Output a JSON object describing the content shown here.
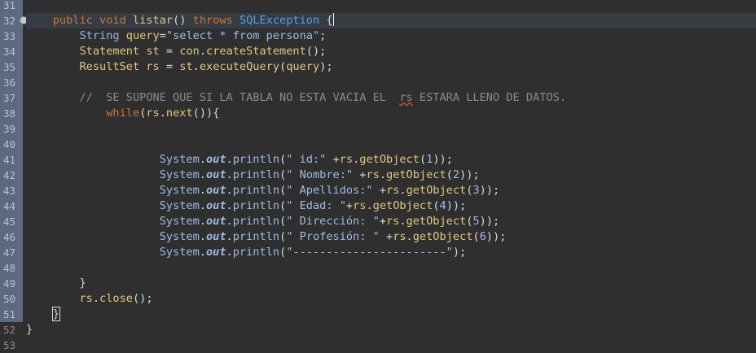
{
  "line_numbers": [
    "31",
    "32",
    "33",
    "34",
    "35",
    "36",
    "37",
    "38",
    "39",
    "40",
    "41",
    "42",
    "43",
    "44",
    "45",
    "46",
    "47",
    "48",
    "49",
    "50",
    "51",
    "52",
    "53"
  ],
  "code": {
    "l32": {
      "kw1": "public void ",
      "name": "listar",
      "p1": "() ",
      "kw2": "throws ",
      "ex": "SQLException",
      "p2": " {"
    },
    "l33": {
      "t": "String ",
      "v": "query",
      "eq": "=",
      "s": "\"select * from persona\"",
      "e": ";"
    },
    "l34": {
      "t": "Statement ",
      "v": "st",
      "eq": " = ",
      "o": "con",
      "d": ".",
      "m": "createStatement",
      "e": "();"
    },
    "l35": {
      "t": "ResultSet ",
      "v": "rs",
      "eq": " = ",
      "o": "st",
      "d": ".",
      "m": "executeQuery",
      "p": "(",
      "a": "query",
      "e": ");"
    },
    "l37": {
      "c1": "//  SE SUPONE QUE SI LA TABLA NO ESTA VACIA EL  ",
      "c2": "rs",
      "c3": " ESTARA LLENO DE DATOS."
    },
    "l38": {
      "k": "while",
      "p": "(",
      "o": "rs",
      "d": ".",
      "m": "next",
      "e": "()){"
    },
    "prints": [
      {
        "cls": "System",
        "fld": "out",
        "m": "println",
        "s": "\" id:\"",
        "plus": " +",
        "o": "rs",
        "g": "getObject",
        "n": "1",
        "e": "));"
      },
      {
        "cls": "System",
        "fld": "out",
        "m": "println",
        "s": "\" Nombre:\"",
        "plus": " +",
        "o": "rs",
        "g": "getObject",
        "n": "2",
        "e": "));"
      },
      {
        "cls": "System",
        "fld": "out",
        "m": "println",
        "s": "\" Apellidos:\"",
        "plus": " +",
        "o": "rs",
        "g": "getObject",
        "n": "3",
        "e": "));"
      },
      {
        "cls": "System",
        "fld": "out",
        "m": "println",
        "s": "\" Edad: \"",
        "plus": "+",
        "o": "rs",
        "g": "getObject",
        "n": "4",
        "e": "));"
      },
      {
        "cls": "System",
        "fld": "out",
        "m": "println",
        "s": "\" Dirección: \"",
        "plus": "+",
        "o": "rs",
        "g": "getObject",
        "n": "5",
        "e": "));"
      },
      {
        "cls": "System",
        "fld": "out",
        "m": "println",
        "s": "\" Profesión: \"",
        "plus": " +",
        "o": "rs",
        "g": "getObject",
        "n": "6",
        "e": "));"
      }
    ],
    "l47": {
      "cls": "System",
      "fld": "out",
      "m": "println",
      "s": "\"-----------------------\"",
      "e": ");"
    },
    "l49": {
      "b": "}"
    },
    "l50": {
      "o": "rs",
      "d": ".",
      "m": "close",
      "e": "();"
    },
    "l51": {
      "b": "}"
    },
    "l52": {
      "b": "}"
    }
  }
}
